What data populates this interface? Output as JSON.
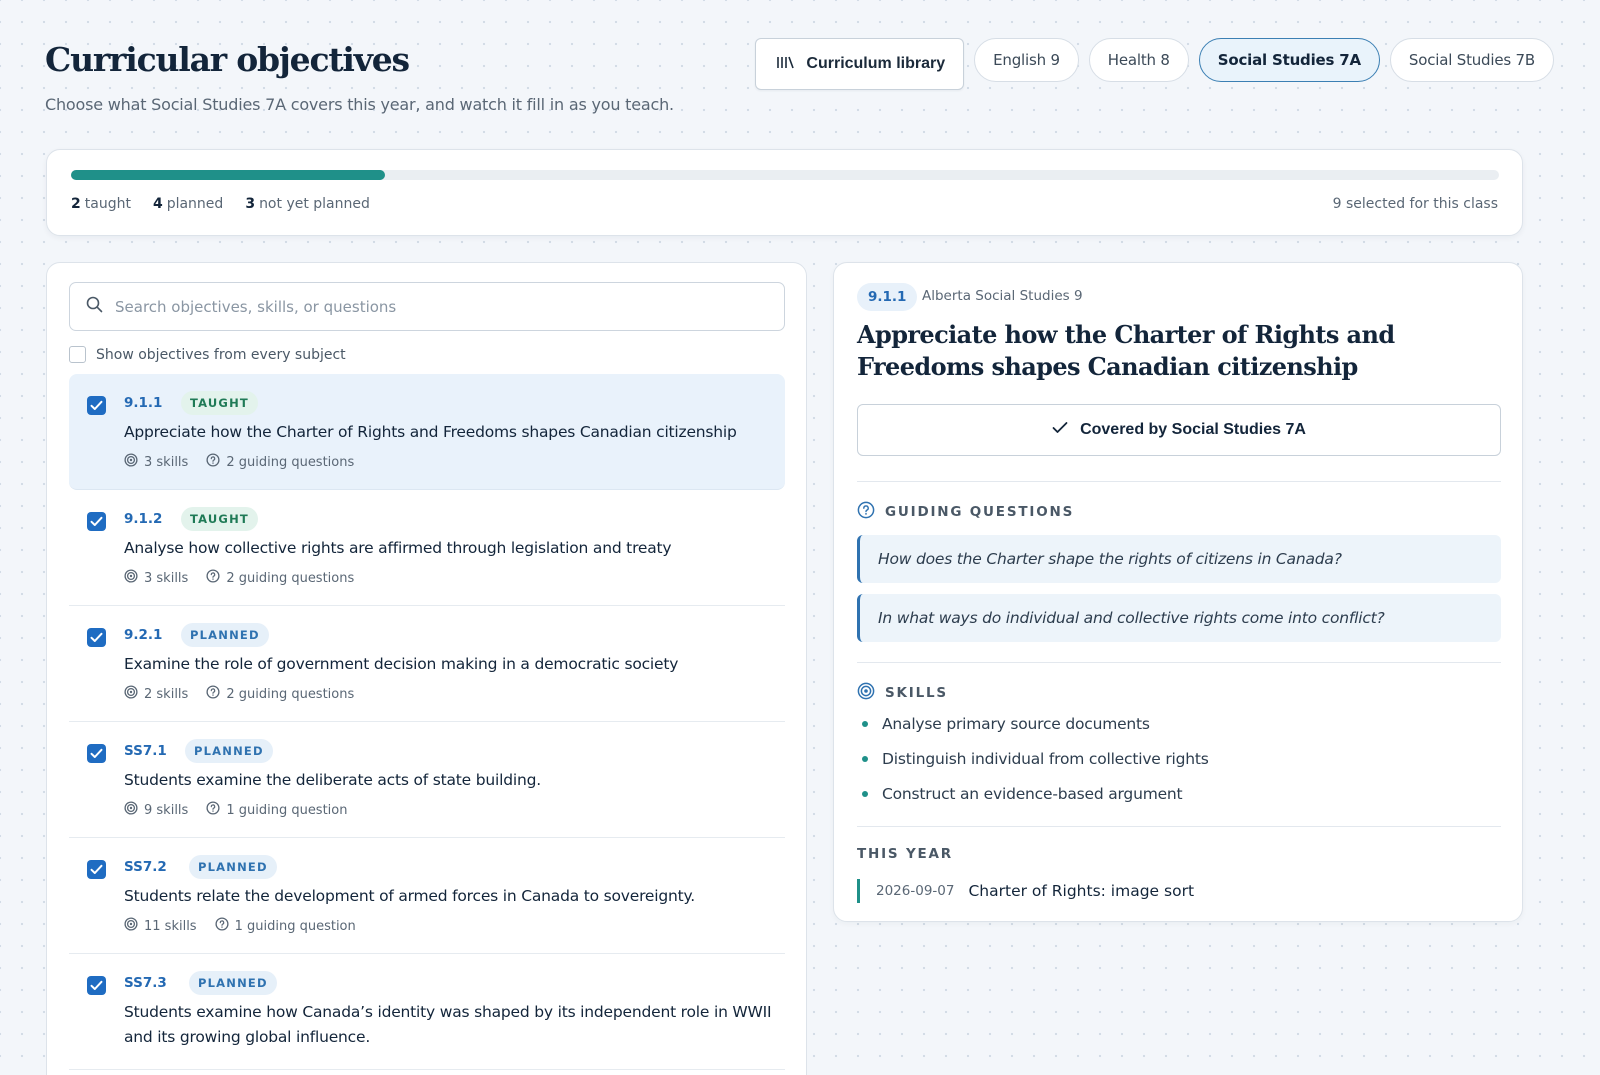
{
  "header": {
    "title": "Curricular objectives",
    "subtitle": "Choose what Social Studies 7A covers this year, and watch it fill in as you teach.",
    "library_label": "Curriculum library",
    "tabs": [
      "English 9",
      "Health 8",
      "Social Studies 7A",
      "Social Studies 7B"
    ],
    "active_tab": "Social Studies 7A"
  },
  "progress": {
    "fraction": 0.22,
    "taught_count": "2",
    "taught_label": "taught",
    "planned_count": "4",
    "planned_label": "planned",
    "unplanned_count": "3",
    "unplanned_label": "not yet planned",
    "selected_text": "9 selected for this class",
    "color": "#1f9089"
  },
  "search": {
    "placeholder": "Search objectives, skills, or questions",
    "value": ""
  },
  "show_all_label": "Show objectives from every subject",
  "objectives": [
    {
      "code": "9.1.1",
      "status": "TAUGHT",
      "text": "Appreciate how the Charter of Rights and Freedoms shapes Canadian citizenship",
      "skills": "3 skills",
      "questions": "2 guiding questions"
    },
    {
      "code": "9.1.2",
      "status": "TAUGHT",
      "text": "Analyse how collective rights are affirmed through legislation and treaty",
      "skills": "3 skills",
      "questions": "2 guiding questions"
    },
    {
      "code": "9.2.1",
      "status": "PLANNED",
      "text": "Examine the role of government decision making in a democratic society",
      "skills": "2 skills",
      "questions": "2 guiding questions"
    },
    {
      "code": "SS7.1",
      "status": "PLANNED",
      "text": "Students examine the deliberate acts of state building.",
      "skills": "9 skills",
      "questions": "1 guiding question"
    },
    {
      "code": "SS7.2",
      "status": "PLANNED",
      "text": "Students relate the development of armed forces in Canada to sovereignty.",
      "skills": "11 skills",
      "questions": "1 guiding question"
    },
    {
      "code": "SS7.3",
      "status": "PLANNED",
      "text": "Students examine how Canada’s identity was shaped by its independent role in WWII and its growing global influence.",
      "skills": "",
      "questions": ""
    }
  ],
  "detail": {
    "code": "9.1.1",
    "source": "Alberta Social Studies 9",
    "title": "Appreciate how the Charter of Rights and Freedoms shapes Canadian citizenship",
    "covered_label": "Covered by Social Studies 7A",
    "questions_heading": "GUIDING QUESTIONS",
    "questions": [
      "How does the Charter shape the rights of citizens in Canada?",
      "In what ways do individual and collective rights come into conflict?"
    ],
    "skills_heading": "SKILLS",
    "skills": [
      "Analyse primary source documents",
      "Distinguish individual from collective rights",
      "Construct an evidence-based argument"
    ],
    "year_heading": "THIS YEAR",
    "year_entries": [
      {
        "date": "2026-09-07",
        "title": "Charter of Rights: image sort"
      }
    ]
  }
}
